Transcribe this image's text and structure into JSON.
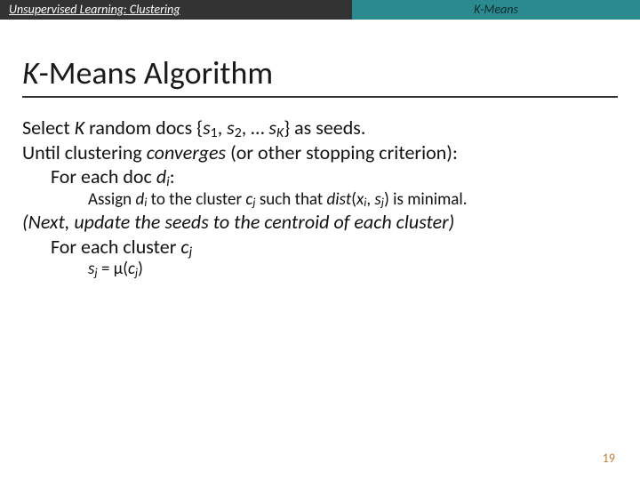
{
  "header": {
    "left": "Unsupervised Learning: Clustering",
    "right": "K-Means"
  },
  "title": {
    "italic_part": "K",
    "rest": "-Means Algorithm"
  },
  "body": {
    "l1_a": "Select ",
    "l1_K": "K",
    "l1_b": " random docs {",
    "l1_s": "s",
    "l1_c": ", ",
    "l1_d": ", … ",
    "l1_Ksub": "K",
    "l1_e": "} as seeds.",
    "sub1": "1",
    "sub2": "2",
    "l2_a": "Until clustering ",
    "l2_conv": "converges",
    "l2_b": " (or other stopping criterion):",
    "l3_a": "For each doc ",
    "l3_d": "d",
    "l3_isub": "i",
    "l3_colon": ":",
    "l4_a": "Assign ",
    "l4_d": "d",
    "l4_b": " to the cluster ",
    "l4_c": "c",
    "l4_jsub": "j",
    "l4_such": " such that ",
    "l4_dist": "dist",
    "l4_p1": "(",
    "l4_x": "x",
    "l4_comma": ", ",
    "l4_s": "s",
    "l4_p2": ") is minimal.",
    "l5": "(Next, update the seeds to the centroid of each cluster)",
    "l6_a": "For each cluster ",
    "l6_c": "c",
    "l7_s": "s",
    "l7_eq": " = ",
    "l7_mu": "μ",
    "l7_p1": "(",
    "l7_c": "c",
    "l7_p2": ")"
  },
  "page_number": "19"
}
